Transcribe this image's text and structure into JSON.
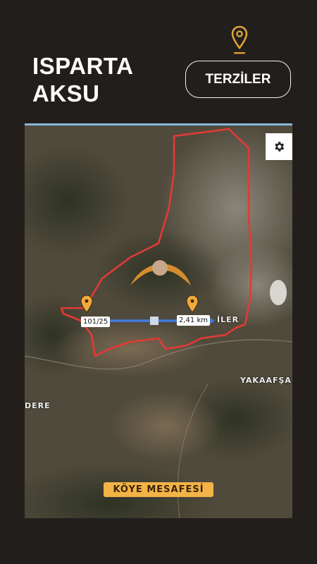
{
  "header": {
    "title_line1": "ISPARTA",
    "title_line2": "AKSU",
    "village_button_label": "TERZİLER",
    "location_icon": "map-pin-icon"
  },
  "map": {
    "settings_icon": "gear-icon",
    "distance_start_label": "101/25",
    "distance_end_label": "2,41 km",
    "village_name_partial": "İLER",
    "place_label_east": "YAKAAFŞAR",
    "place_label_west": "DERE",
    "caption": "KÖYE MESAFESİ",
    "boundary_color": "#e53935",
    "distance_line_color": "#3f7be0",
    "marker_color": "#f2a93b"
  }
}
